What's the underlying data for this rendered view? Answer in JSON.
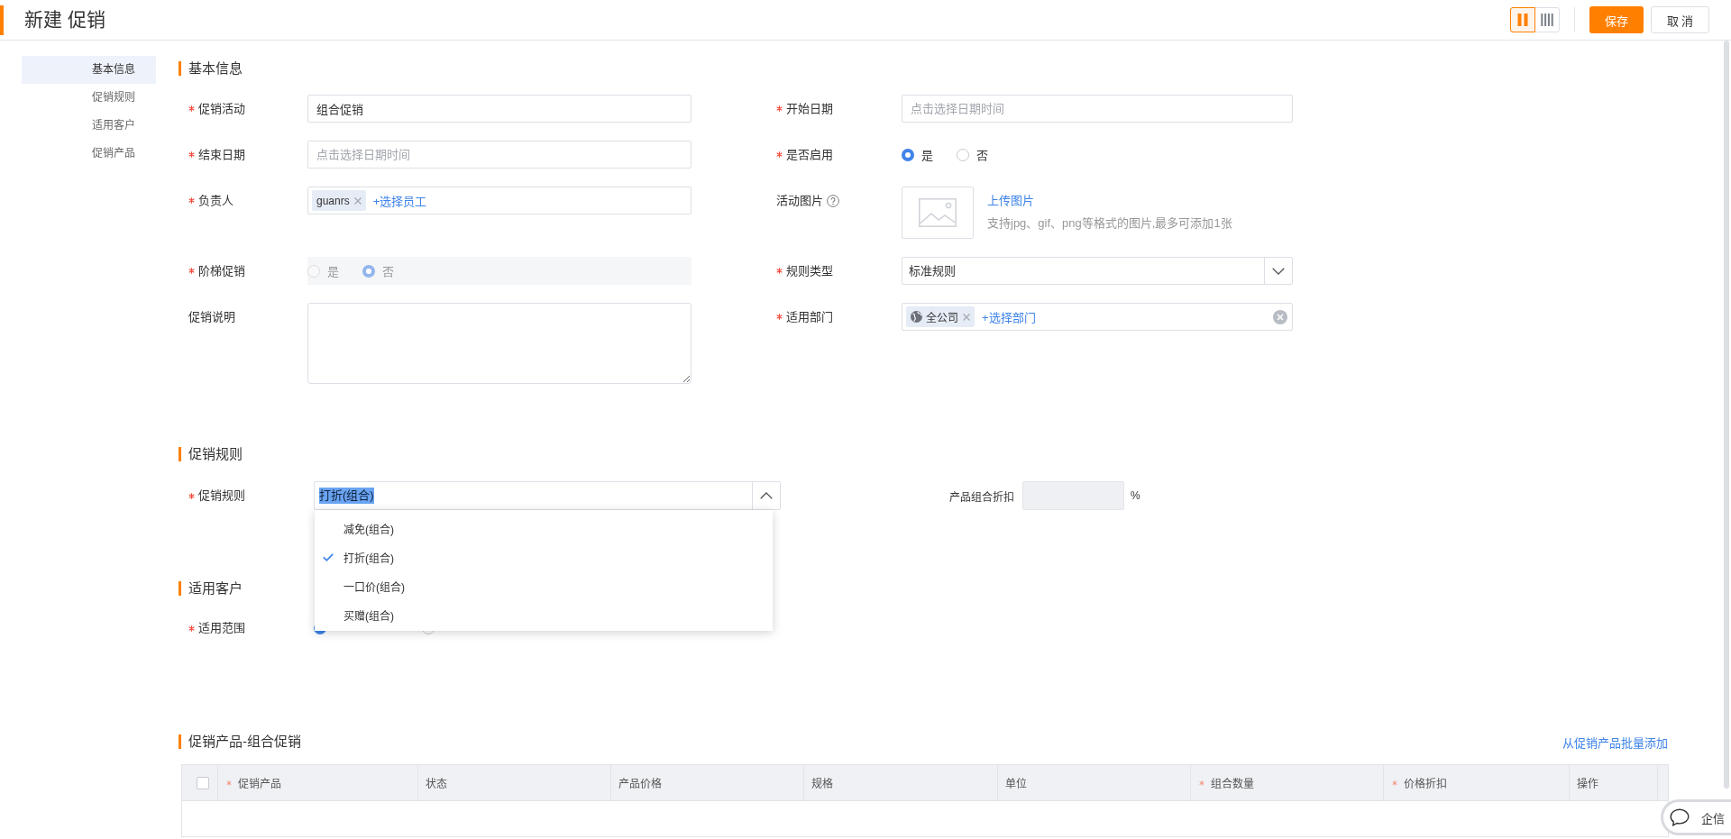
{
  "header": {
    "title": "新建 促销",
    "view_modes": [
      {
        "kind": "two-column",
        "selected": true
      },
      {
        "kind": "four-column",
        "selected": false
      }
    ],
    "buttons": [
      {
        "label": "保存",
        "kind": "primary"
      },
      {
        "label": "取 消",
        "kind": "default"
      }
    ]
  },
  "sidebar": {
    "items": [
      {
        "label": "基本信息",
        "selected": true
      },
      {
        "label": "促销规则",
        "selected": false
      },
      {
        "label": "适用客户",
        "selected": false
      },
      {
        "label": "促销产品",
        "selected": false
      }
    ]
  },
  "basic_info": {
    "title": "基本信息",
    "fields": [
      {
        "kind": "text",
        "label": "促销活动",
        "required": true,
        "value": "组合促销"
      },
      {
        "kind": "text",
        "label": "开始日期",
        "required": true,
        "placeholder": "点击选择日期时间"
      },
      {
        "kind": "text",
        "label": "结束日期",
        "required": true,
        "placeholder": "点击选择日期时间"
      },
      {
        "kind": "radio",
        "label": "是否启用",
        "required": true,
        "disabled": false,
        "options": [
          {
            "label": "是",
            "selected": true
          },
          {
            "label": "否",
            "selected": false
          }
        ]
      },
      {
        "kind": "tags",
        "label": "负责人",
        "required": true,
        "tags": [
          {
            "kind": "employee",
            "label": "guanrs"
          }
        ],
        "add_link": "+选择员工",
        "clearable": false
      },
      {
        "kind": "image",
        "label": "活动图片",
        "required": false,
        "help": true,
        "link": "上传图片",
        "hint": "支持jpg、gif、png等格式的图片,最多可添加1张"
      },
      {
        "kind": "radio",
        "label": "阶梯促销",
        "required": true,
        "disabled": true,
        "options": [
          {
            "label": "是",
            "selected": false
          },
          {
            "label": "否",
            "selected": true
          }
        ]
      },
      {
        "kind": "select",
        "label": "规则类型",
        "required": true,
        "value": "标准规则",
        "expanded": false
      },
      {
        "kind": "textarea",
        "label": "促销说明",
        "required": false
      },
      {
        "kind": "tags",
        "label": "适用部门",
        "required": true,
        "tags": [
          {
            "kind": "department",
            "label": "全公司"
          }
        ],
        "add_link": "+选择部门",
        "clearable": true
      }
    ]
  },
  "promo_rules": {
    "title": "促销规则",
    "rule": {
      "label": "促销规则",
      "required": true,
      "value": "打折(组合)",
      "text_highlighted": true,
      "expanded": true,
      "options": [
        {
          "label": "减免(组合)",
          "selected": false
        },
        {
          "label": "打折(组合)",
          "selected": true
        },
        {
          "label": "一口价(组合)",
          "selected": false
        },
        {
          "label": "买赠(组合)",
          "selected": false
        }
      ]
    },
    "discount": {
      "label": "产品组合折扣",
      "unit": "%",
      "disabled": true
    }
  },
  "customers": {
    "title": "适用客户",
    "scope": {
      "label": "适用范围",
      "required": true,
      "options": [
        {
          "selected": true
        },
        {
          "selected": false
        }
      ]
    }
  },
  "products": {
    "title": "促销产品-组合促销",
    "action": "从促销产品批量添加",
    "table": {
      "select_all": {
        "checked": false
      },
      "columns": [
        {
          "label": "促销产品",
          "required": true
        },
        {
          "label": "状态",
          "required": false
        },
        {
          "label": "产品价格",
          "required": false
        },
        {
          "label": "规格",
          "required": false
        },
        {
          "label": "单位",
          "required": false
        },
        {
          "label": "组合数量",
          "required": true
        },
        {
          "label": "价格折扣",
          "required": true
        },
        {
          "label": "操作",
          "required": false
        }
      ]
    }
  },
  "chat_widget": {
    "label": "企信"
  }
}
